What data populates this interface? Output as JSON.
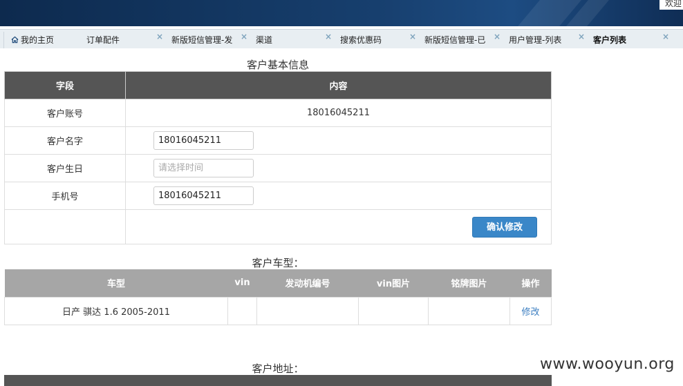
{
  "topbar": {
    "welcome_text": "欢迎"
  },
  "tabs": [
    {
      "label": "我的主页",
      "icon": "home-icon",
      "closable": false,
      "active": false
    },
    {
      "label": "订单配件",
      "closable": true,
      "active": false
    },
    {
      "label": "新版短信管理-发",
      "closable": true,
      "active": false
    },
    {
      "label": "渠道",
      "closable": true,
      "active": false
    },
    {
      "label": "搜索优惠码",
      "closable": true,
      "active": false
    },
    {
      "label": "新版短信管理-已",
      "closable": true,
      "active": false
    },
    {
      "label": "用户管理-列表",
      "closable": true,
      "active": false
    },
    {
      "label": "客户列表",
      "closable": true,
      "active": true
    }
  ],
  "close_glyph": "×",
  "basic_info": {
    "title": "客户基本信息",
    "headers": {
      "field": "字段",
      "content": "内容"
    },
    "account": {
      "label": "客户账号",
      "value": "18016045211"
    },
    "name": {
      "label": "客户名字",
      "value": "18016045211"
    },
    "birthday": {
      "label": "客户生日",
      "placeholder": "请选择时间"
    },
    "phone": {
      "label": "手机号",
      "value": "18016045211"
    },
    "confirm_button": "确认修改"
  },
  "car_models": {
    "title": "客户车型：",
    "headers": [
      "车型",
      "vin",
      "发动机编号",
      "vin图片",
      "铭牌图片",
      "操作"
    ],
    "rows": [
      {
        "model": "日产 骐达 1.6 2005-2011",
        "vin": "",
        "engine": "",
        "vin_image": "",
        "plate_image": "",
        "action": "修改"
      }
    ]
  },
  "address": {
    "title": "客户地址："
  },
  "watermark": "www.wooyun.org",
  "colors": {
    "primary_button": "#3a87c8",
    "header_dark": "#555555",
    "header_gray": "#a6a6a6",
    "link": "#3a7dc0"
  }
}
